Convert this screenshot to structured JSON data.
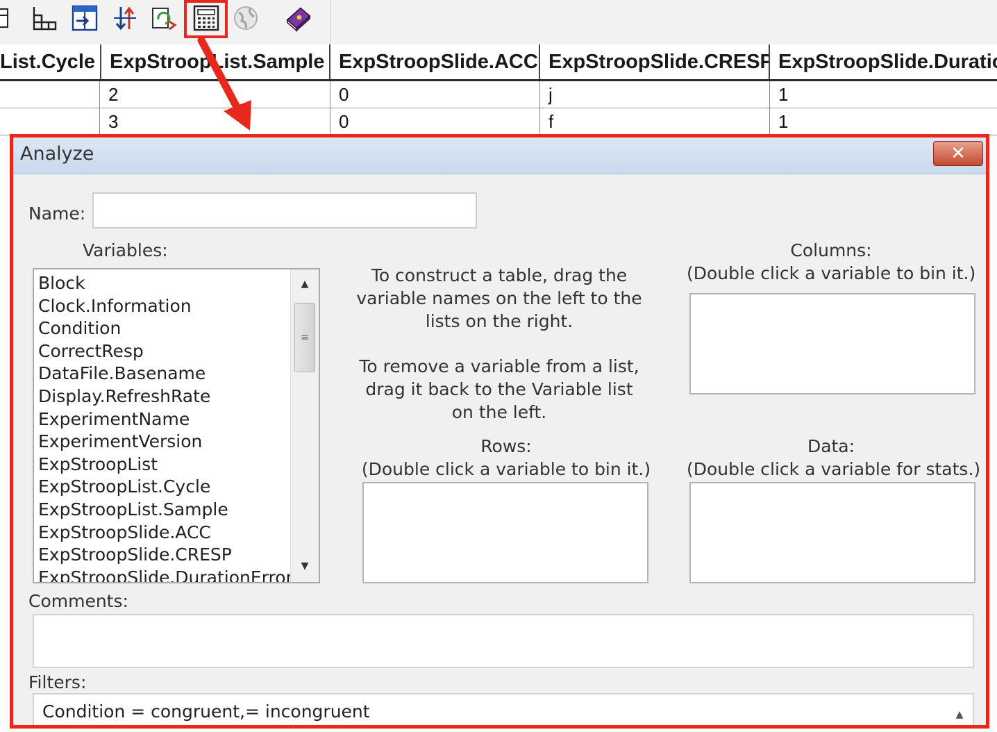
{
  "toolbar": {
    "icons": [
      "table-icon",
      "grid-icon",
      "import-icon",
      "sort-icon",
      "refresh-icon",
      "analyze-icon",
      "globe-icon",
      "book-icon"
    ]
  },
  "grid": {
    "columns": [
      "List.Cycle",
      "ExpStroopList.Sample",
      "ExpStroopSlide.ACC",
      "ExpStroopSlide.CRESP",
      "ExpStroopSlide.Duratio"
    ],
    "rows": [
      [
        "",
        "2",
        "0",
        "j",
        "1"
      ],
      [
        "",
        "3",
        "0",
        "f",
        "1"
      ]
    ]
  },
  "dialog": {
    "title": "Analyze",
    "close_label": "✕",
    "name_label": "Name:",
    "name_value": "",
    "variables_label": "Variables:",
    "variables": [
      "Block",
      "Clock.Information",
      "Condition",
      "CorrectResp",
      "DataFile.Basename",
      "Display.RefreshRate",
      "ExperimentName",
      "ExperimentVersion",
      "ExpStroopList",
      "ExpStroopList.Cycle",
      "ExpStroopList.Sample",
      "ExpStroopSlide.ACC",
      "ExpStroopSlide.CRESP",
      "ExpStroopSlide.DurationError"
    ],
    "instructions_1": "To construct a table, drag the variable names on the left to the lists on the right.",
    "instructions_2": "To remove a variable from a list, drag it back to the Variable list on the left.",
    "columns_label": "Columns:",
    "columns_hint": "(Double click a variable to bin it.)",
    "rows_label": "Rows:",
    "rows_hint": "(Double click a variable to bin it.)",
    "data_label": "Data:",
    "data_hint": "(Double click a variable for stats.)",
    "comments_label": "Comments:",
    "filters_label": "Filters:",
    "filters_value": "Condition = congruent,= incongruent"
  },
  "colors": {
    "highlight": "#e8281c",
    "titlebar": "#c9d9ec",
    "dialog_bg": "#f0f0f0"
  }
}
